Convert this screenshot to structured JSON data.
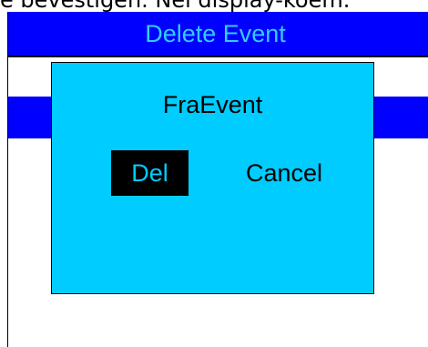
{
  "top_caption": "e bevestigen. Nei display-koem.",
  "header": {
    "title": "Delete Event"
  },
  "dialog": {
    "title": "FraEvent",
    "del_label": "Del",
    "cancel_label": "Cancel"
  },
  "colors": {
    "header_background": "#0000ff",
    "header_text": "#33ccff",
    "dialog_background": "#00ccff",
    "selected_button_background": "#000000",
    "selected_button_text": "#00ccff"
  }
}
